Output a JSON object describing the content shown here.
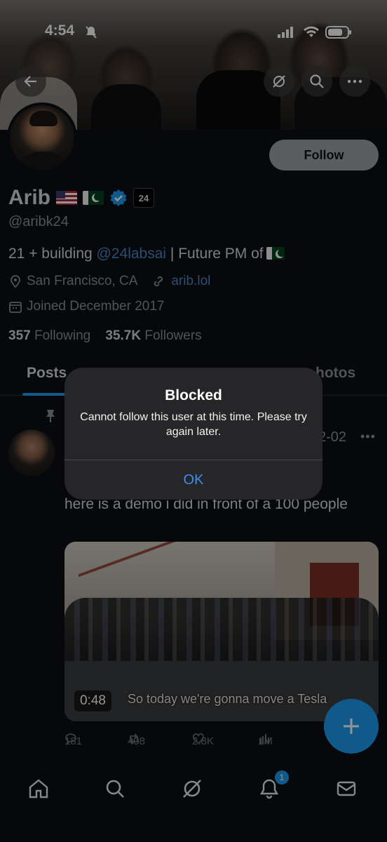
{
  "status_bar": {
    "time": "4:54"
  },
  "profile": {
    "follow_label": "Follow",
    "name": "Arib",
    "badge_text": "24",
    "handle": "@aribk24",
    "bio_prefix": "21 + building ",
    "bio_link": "@24labsai",
    "bio_suffix": " | Future PM of",
    "location": "San Francisco, CA",
    "website": "arib.lol",
    "joined": "Joined December 2017",
    "following_count": "357",
    "following_label": "Following",
    "followers_count": "35.7K",
    "followers_label": "Followers"
  },
  "tabs": {
    "posts": "Posts",
    "photos": "hotos"
  },
  "post": {
    "date": "2-02",
    "text": "here is a demo i did in front of a 100 people",
    "video_duration": "0:48",
    "video_caption": "So today we're gonna move a Tesla",
    "replies": "181",
    "reposts": "408",
    "likes": "2.8K",
    "views": "1M"
  },
  "bottom_nav": {
    "notif_count": "1"
  },
  "alert": {
    "title": "Blocked",
    "message": "Cannot follow this user at this time. Please try again later.",
    "ok_label": "OK"
  },
  "colors": {
    "accent": "#1d9bf0",
    "alert_button": "#3d8ef0",
    "background": "#0b0f14"
  }
}
